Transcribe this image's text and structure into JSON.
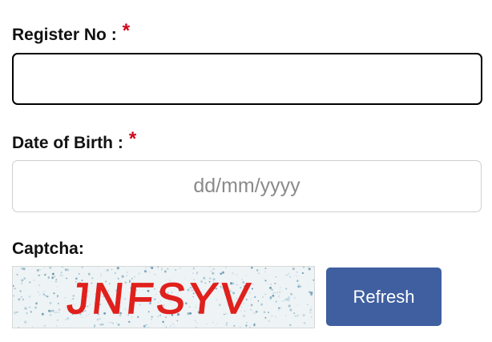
{
  "register": {
    "label": "Register No :",
    "required_marker": "*",
    "value": ""
  },
  "dob": {
    "label": "Date of Birth :",
    "required_marker": "*",
    "placeholder": "dd/mm/yyyy"
  },
  "captcha": {
    "label": "Captcha:",
    "text": "JNFSYV",
    "text_color": "#e0201c",
    "refresh_label": "Refresh"
  },
  "colors": {
    "required": "#d0021b",
    "refresh_button": "#3f5fa0"
  }
}
